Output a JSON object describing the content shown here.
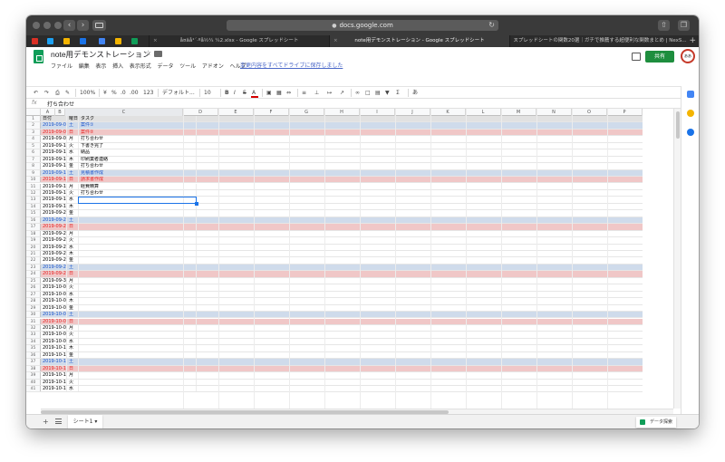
{
  "browser": {
    "url": "docs.google.com",
    "tabs": [
      {
        "label": "å¤â­å¹´·ºå½¼ ¼2.xlsx - Google スプレッドシート",
        "active": false
      },
      {
        "label": "note用デモンストレーション - Google スプレッドシート",
        "active": true
      },
      {
        "label": "スプレッドシートの関数20選｜ガチで推薦する超便利な関数まとめ | NexS...",
        "active": false
      }
    ],
    "favicons": [
      "#d93025",
      "#1da1f2",
      "#f4b400",
      "#1a73e8",
      "#4285f4",
      "#f4b400",
      "#0f9d58"
    ]
  },
  "doc": {
    "title": "note用デモンストレーション",
    "menu": [
      "ファイル",
      "編集",
      "表示",
      "挿入",
      "表示形式",
      "データ",
      "ツール",
      "アドオン",
      "ヘルプ"
    ],
    "save_notice": "変更内容をすべてドライブに保存しました",
    "share_label": "共有",
    "avatar_text": "ああ"
  },
  "toolbar": {
    "zoom": "100%",
    "currency": "¥",
    "percent": "%",
    "decimals_less": ".0",
    "decimals_more": ".00",
    "number_format": "123",
    "font": "デフォルト...",
    "font_size": "10",
    "bold": "B",
    "italic": "I",
    "strike": "S",
    "text_color": "A",
    "sum": "Σ",
    "input_tools": "あ"
  },
  "formula": {
    "fx": "fx",
    "value": "打ち合わせ"
  },
  "sheet": {
    "columns": [
      "A",
      "B",
      "C",
      "D",
      "E",
      "F",
      "G",
      "H",
      "I",
      "J",
      "K",
      "L",
      "M",
      "N",
      "O",
      "P"
    ],
    "header_row": {
      "date": "日付",
      "weekday": "曜日",
      "task": "タスク"
    },
    "rows": [
      {
        "date": "2019-09-07",
        "weekday": "土",
        "task": "案件①",
        "type": "sat"
      },
      {
        "date": "2019-09-08",
        "weekday": "日",
        "task": "案件②",
        "type": "sun"
      },
      {
        "date": "2019-09-09",
        "weekday": "月",
        "task": "打ち合わせ",
        "type": ""
      },
      {
        "date": "2019-09-10",
        "weekday": "火",
        "task": "下書き完了",
        "type": ""
      },
      {
        "date": "2019-09-11",
        "weekday": "水",
        "task": "納品",
        "type": ""
      },
      {
        "date": "2019-09-12",
        "weekday": "木",
        "task": "印刷業者連絡",
        "type": ""
      },
      {
        "date": "2019-09-13",
        "weekday": "金",
        "task": "打ち合わせ",
        "type": ""
      },
      {
        "date": "2019-09-14",
        "weekday": "土",
        "task": "見積書作成",
        "type": "sat"
      },
      {
        "date": "2019-09-15",
        "weekday": "日",
        "task": "請求書作成",
        "type": "sun"
      },
      {
        "date": "2019-09-16",
        "weekday": "月",
        "task": "経費精算",
        "type": ""
      },
      {
        "date": "2019-09-17",
        "weekday": "火",
        "task": "打ち合わせ",
        "type": ""
      },
      {
        "date": "2019-09-18",
        "weekday": "水",
        "task": "",
        "type": ""
      },
      {
        "date": "2019-09-19",
        "weekday": "木",
        "task": "",
        "type": ""
      },
      {
        "date": "2019-09-20",
        "weekday": "金",
        "task": "",
        "type": ""
      },
      {
        "date": "2019-09-21",
        "weekday": "土",
        "task": "",
        "type": "sat"
      },
      {
        "date": "2019-09-22",
        "weekday": "日",
        "task": "",
        "type": "sun"
      },
      {
        "date": "2019-09-23",
        "weekday": "月",
        "task": "",
        "type": ""
      },
      {
        "date": "2019-09-24",
        "weekday": "火",
        "task": "",
        "type": ""
      },
      {
        "date": "2019-09-25",
        "weekday": "水",
        "task": "",
        "type": ""
      },
      {
        "date": "2019-09-26",
        "weekday": "木",
        "task": "",
        "type": ""
      },
      {
        "date": "2019-09-27",
        "weekday": "金",
        "task": "",
        "type": ""
      },
      {
        "date": "2019-09-28",
        "weekday": "土",
        "task": "",
        "type": "sat"
      },
      {
        "date": "2019-09-29",
        "weekday": "日",
        "task": "",
        "type": "sun"
      },
      {
        "date": "2019-09-30",
        "weekday": "月",
        "task": "",
        "type": ""
      },
      {
        "date": "2019-10-01",
        "weekday": "火",
        "task": "",
        "type": ""
      },
      {
        "date": "2019-10-02",
        "weekday": "水",
        "task": "",
        "type": ""
      },
      {
        "date": "2019-10-03",
        "weekday": "木",
        "task": "",
        "type": ""
      },
      {
        "date": "2019-10-04",
        "weekday": "金",
        "task": "",
        "type": ""
      },
      {
        "date": "2019-10-05",
        "weekday": "土",
        "task": "",
        "type": "sat"
      },
      {
        "date": "2019-10-06",
        "weekday": "日",
        "task": "",
        "type": "sun"
      },
      {
        "date": "2019-10-07",
        "weekday": "月",
        "task": "",
        "type": ""
      },
      {
        "date": "2019-10-08",
        "weekday": "火",
        "task": "",
        "type": ""
      },
      {
        "date": "2019-10-09",
        "weekday": "水",
        "task": "",
        "type": ""
      },
      {
        "date": "2019-10-10",
        "weekday": "木",
        "task": "",
        "type": ""
      },
      {
        "date": "2019-10-11",
        "weekday": "金",
        "task": "",
        "type": ""
      },
      {
        "date": "2019-10-12",
        "weekday": "土",
        "task": "",
        "type": "sat"
      },
      {
        "date": "2019-10-13",
        "weekday": "日",
        "task": "",
        "type": "sun"
      },
      {
        "date": "2019-10-14",
        "weekday": "月",
        "task": "",
        "type": ""
      },
      {
        "date": "2019-10-15",
        "weekday": "火",
        "task": "",
        "type": ""
      },
      {
        "date": "2019-10-16",
        "weekday": "水",
        "task": "",
        "type": ""
      }
    ],
    "selected_row": 11,
    "sheet_tab": "シート1",
    "explore_label": "データ探索"
  },
  "colors": {
    "saturday_bg": "#cfdbeb",
    "saturday_text": "#1a53c9",
    "sunday_bg": "#f0c7c7",
    "sunday_text": "#e52020",
    "header_bg": "#e1e1e1",
    "share_green": "#1e8e3e",
    "selection_blue": "#1a73e8"
  },
  "icons": [
    "back-icon",
    "forward-icon",
    "sidebar-icon",
    "lock-icon",
    "reload-icon",
    "share-icon",
    "tabs-icon",
    "star-icon",
    "folder-icon",
    "comment-icon",
    "undo-icon",
    "redo-icon",
    "print-icon",
    "paint-format-icon",
    "fill-color-icon",
    "borders-icon",
    "merge-icon",
    "align-icon",
    "filter-icon",
    "explore-icon"
  ]
}
